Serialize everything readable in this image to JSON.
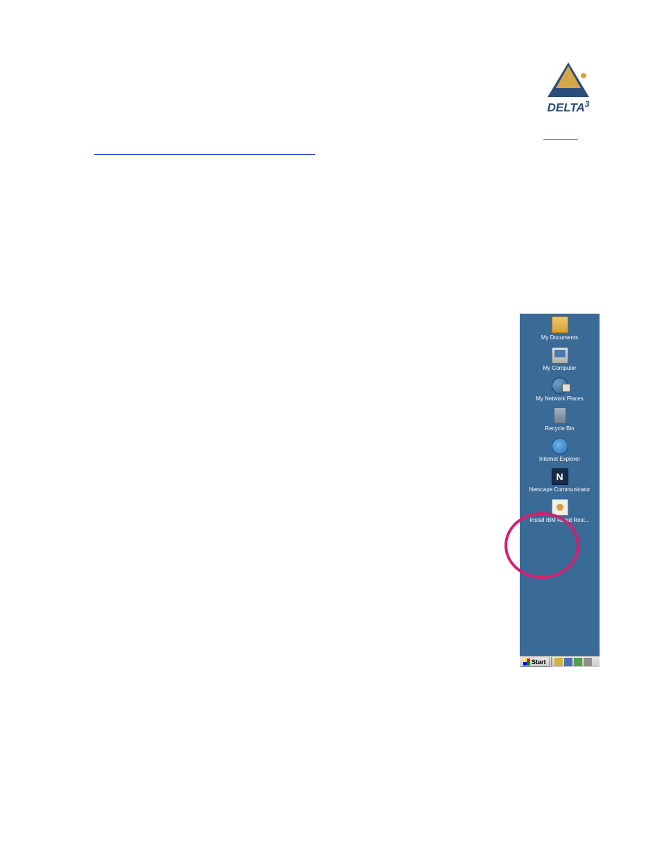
{
  "logo": {
    "text": "DELTA",
    "superscript": "3"
  },
  "desktop": {
    "icons": [
      {
        "name": "my-documents-icon",
        "label": "My Documents"
      },
      {
        "name": "my-computer-icon",
        "label": "My Computer"
      },
      {
        "name": "my-network-places-icon",
        "label": "My Network Places"
      },
      {
        "name": "recycle-bin-icon",
        "label": "Recycle Bin"
      },
      {
        "name": "internet-explorer-icon",
        "label": "Internet Explorer"
      },
      {
        "name": "netscape-communicator-icon",
        "label": "Netscape Communicator"
      },
      {
        "name": "install-ibm-rapid-restore-icon",
        "label": "Install IBM Rapid Rest..."
      }
    ]
  },
  "taskbar": {
    "start_label": "Start"
  }
}
